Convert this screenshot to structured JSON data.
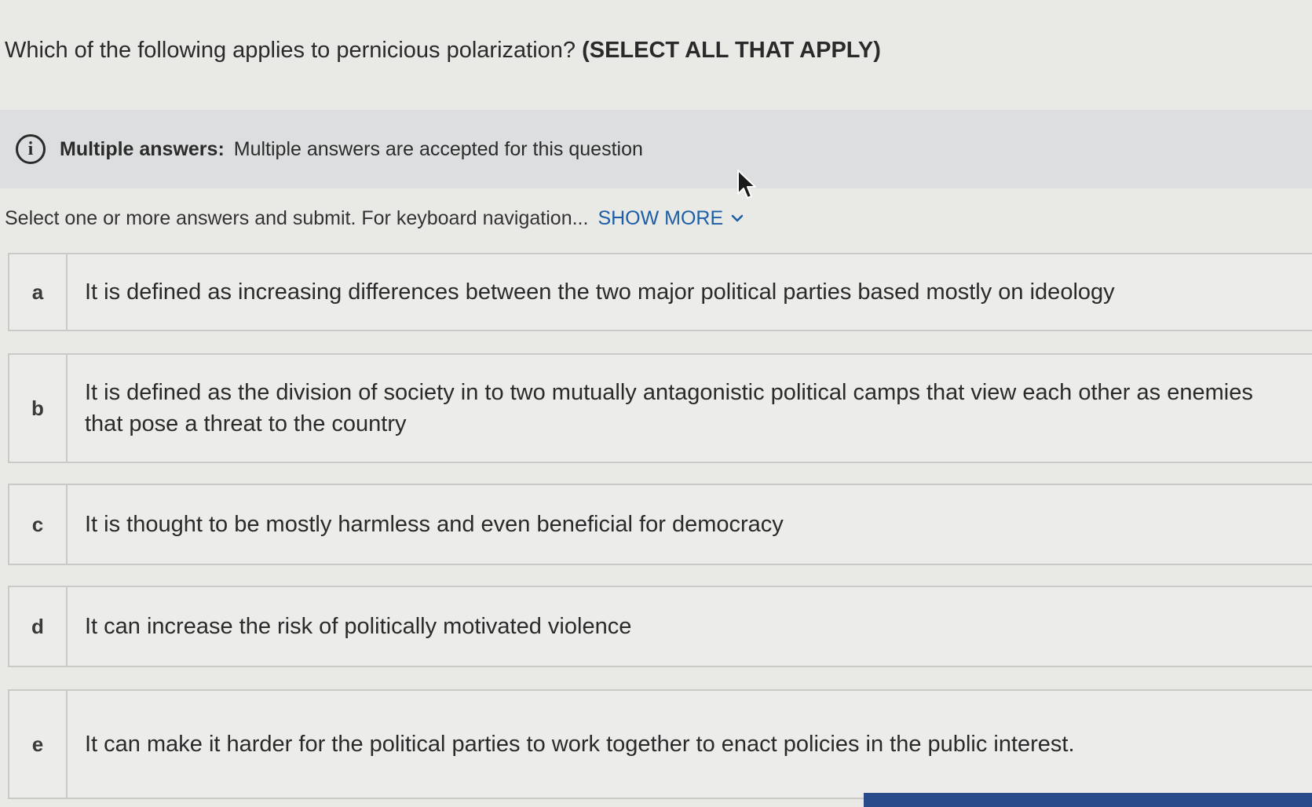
{
  "question": {
    "text": "Which of the following applies to pernicious polarization? ",
    "emphasis": "(SELECT ALL THAT APPLY)"
  },
  "info_banner": {
    "icon": "info-icon",
    "label": "Multiple answers:",
    "text": "Multiple answers are accepted for this question"
  },
  "instructions": {
    "text": "Select one or more answers and submit. For keyboard navigation...",
    "show_more": "SHOW MORE",
    "show_more_icon": "chevron-down-icon"
  },
  "options": [
    {
      "letter": "a",
      "text": "It is defined as increasing differences between the two major political parties based mostly on ideology"
    },
    {
      "letter": "b",
      "text": "It is defined as the division of society in to two mutually antagonistic political camps that view each other as enemies that pose a threat to the country"
    },
    {
      "letter": "c",
      "text": "It is thought to be mostly harmless and even beneficial for democracy"
    },
    {
      "letter": "d",
      "text": "It can increase the risk of politically motivated violence"
    },
    {
      "letter": "e",
      "text": "It can make it harder for the political parties to work together to enact policies in the public interest."
    }
  ],
  "colors": {
    "link": "#1d5ea6",
    "banner": "#dcdedf",
    "background": "#e9e9e6"
  }
}
